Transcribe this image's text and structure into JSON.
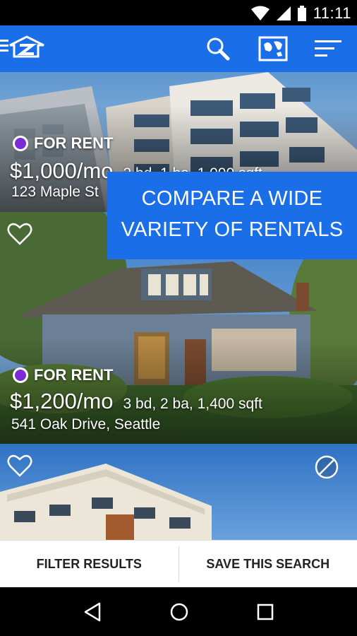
{
  "status_bar": {
    "time": "11:11"
  },
  "colors": {
    "brand": "#1a6ee8",
    "status_dot": "#7a2bd6"
  },
  "app_bar": {
    "logo_icon": "zillow-logo",
    "icons": [
      "search-icon",
      "map-icon",
      "sort-icon"
    ]
  },
  "promo": {
    "line1": "COMPARE A WIDE",
    "line2": "VARIETY OF RENTALS"
  },
  "listings": [
    {
      "status": "FOR RENT",
      "price": "$1,000/mo",
      "details": "2 bd, 1 ba, 1,000 sqft",
      "address": "123 Maple St"
    },
    {
      "status": "FOR RENT",
      "price": "$1,200/mo",
      "details": "3 bd, 2 ba, 1,400 sqft",
      "address": "541 Oak Drive, Seattle"
    },
    {
      "status": "",
      "price": "",
      "details": "",
      "address": ""
    }
  ],
  "actions": {
    "filter_label": "FILTER RESULTS",
    "save_label": "SAVE THIS SEARCH"
  },
  "nav_bar": {
    "icons": [
      "back-icon",
      "home-icon",
      "recents-icon"
    ]
  }
}
